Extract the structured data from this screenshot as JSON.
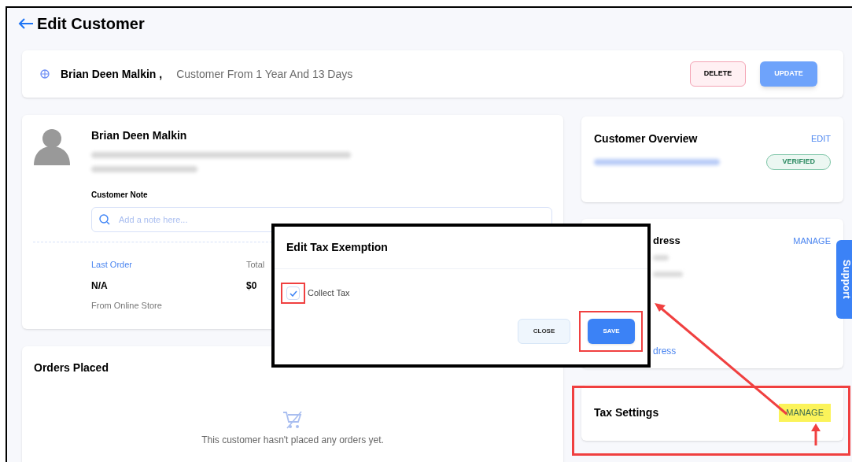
{
  "page_title": "Edit Customer",
  "summary": {
    "name": "Brian Deen Malkin ,",
    "since": "Customer From 1 Year And 13 Days",
    "buttons": [
      {
        "label": "DELETE",
        "kind": "danger"
      },
      {
        "label": "UPDATE",
        "kind": "primary"
      }
    ]
  },
  "profile": {
    "name": "Brian Deen Malkin",
    "note_label": "Customer Note",
    "note_placeholder": "Add a note here...",
    "stats": [
      {
        "label": "Last Order",
        "value": "N/A",
        "sub": "From Online Store"
      },
      {
        "label": "Total",
        "value": "$0"
      }
    ]
  },
  "orders": {
    "title": "Orders Placed",
    "empty_text": "This customer hasn't placed any orders yet."
  },
  "overview": {
    "title": "Customer Overview",
    "action": "EDIT",
    "badge": "VERIFIED"
  },
  "address": {
    "title": "dress",
    "action": "MANAGE",
    "link": "dress"
  },
  "tax": {
    "title": "Tax Settings",
    "action": "MANAGE",
    "highlighted": true
  },
  "support_tab": "Support",
  "modal": {
    "title": "Edit Tax Exemption",
    "checkbox": {
      "label": "Collect Tax",
      "checked": true
    },
    "buttons": [
      {
        "label": "CLOSE",
        "kind": "secondary"
      },
      {
        "label": "SAVE",
        "kind": "primary"
      }
    ]
  }
}
